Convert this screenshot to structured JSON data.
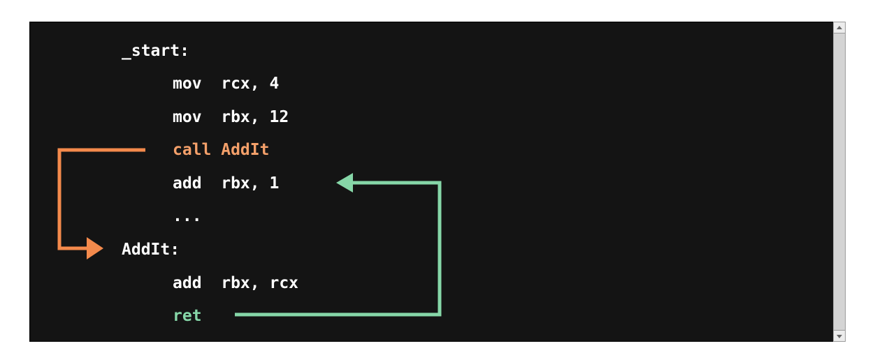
{
  "code": {
    "start_label": "_start:",
    "line1": "mov  rcx, 4",
    "line2": "mov  rbx, 12",
    "call_line": "call AddIt",
    "line4": "add  rbx, 1",
    "ellipsis": "...",
    "addit_label": "AddIt:",
    "line7": "add  rbx, rcx",
    "ret_line": "ret"
  },
  "colors": {
    "background": "#141414",
    "text": "#ffffff",
    "call_highlight": "#f4a06a",
    "ret_highlight": "#86d7a8",
    "call_arrow": "#f48a4c",
    "ret_arrow": "#86d7a8"
  },
  "icons": {
    "scroll_up": "scroll-up-arrow-icon",
    "scroll_down": "scroll-down-arrow-icon"
  }
}
